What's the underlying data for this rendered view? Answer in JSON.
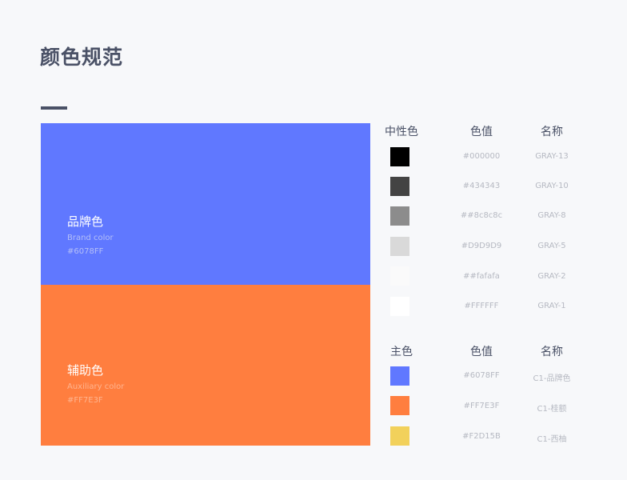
{
  "page_title": "颜色规范",
  "brand_block": {
    "name": "品牌色",
    "english": "Brand color",
    "hex": "#6078FF",
    "color": "#6078FF",
    "text_color": "#b4bff8"
  },
  "aux_block": {
    "name": "辅助色",
    "english": "Auxiliary color",
    "hex": "#FF7E3F",
    "color": "#FF7E3F",
    "text_color": "#ffb48f"
  },
  "neutral_table": {
    "headers": [
      "中性色",
      "色值",
      "名称"
    ],
    "rows": [
      {
        "color": "#000000",
        "hex": "#000000",
        "name": "GRAY-13"
      },
      {
        "color": "#434343",
        "hex": "#434343",
        "name": "GRAY-10"
      },
      {
        "color": "#8c8c8c",
        "hex": "##8c8c8c",
        "name": "GRAY-8"
      },
      {
        "color": "#D9D9D9",
        "hex": "#D9D9D9",
        "name": "GRAY-5"
      },
      {
        "color": "#fafafa",
        "hex": "##fafafa",
        "name": "GRAY-2"
      },
      {
        "color": "#FFFFFF",
        "hex": "#FFFFFF",
        "name": "GRAY-1"
      }
    ]
  },
  "main_table": {
    "headers": [
      "主色",
      "色值",
      "名称"
    ],
    "rows": [
      {
        "color": "#6078FF",
        "hex": "#6078FF",
        "name": "C1-品牌色"
      },
      {
        "color": "#FF7E3F",
        "hex": "#FF7E3F",
        "name": "C1-桂额"
      },
      {
        "color": "#F2D15B",
        "hex": "#F2D15B",
        "name": "C1-西柚"
      }
    ]
  }
}
